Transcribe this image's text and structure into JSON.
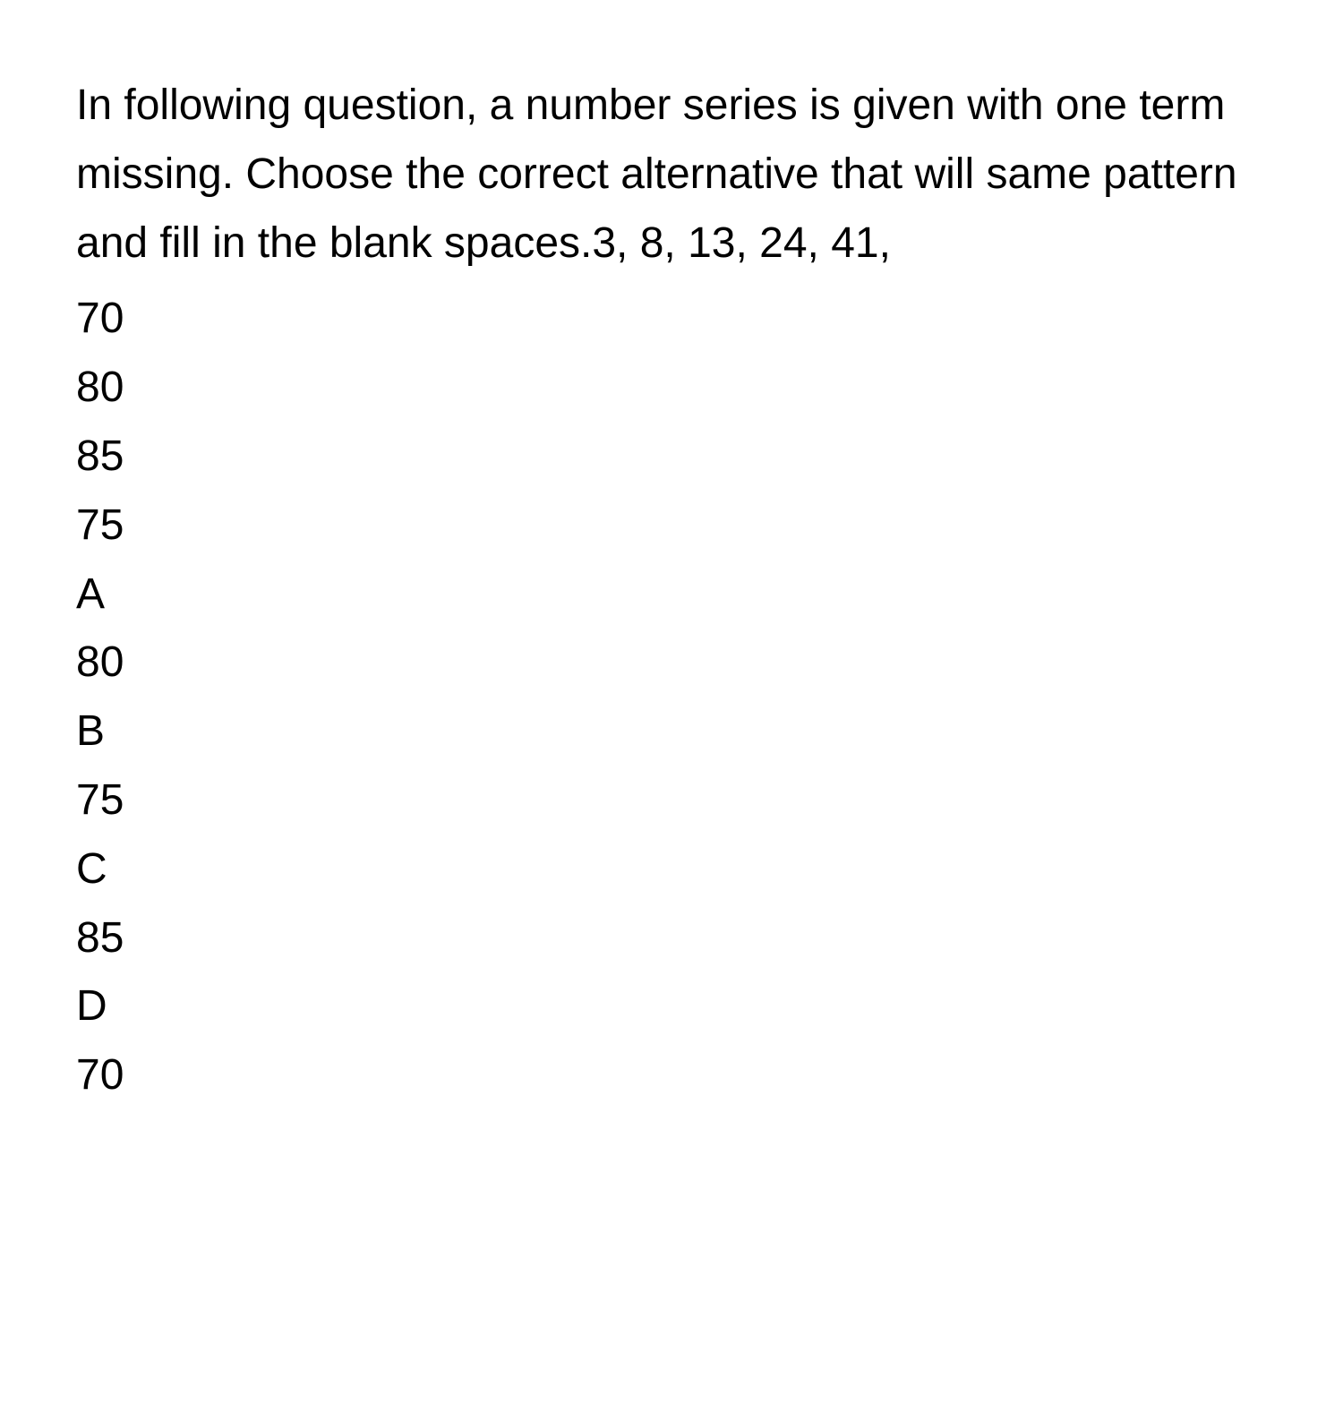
{
  "question": {
    "text": "In following question, a number series is given with one term missing. Choose the correct alternative that will same pattern and fill in the blank spaces.3, 8, 13, 24, 41,"
  },
  "initial_options": [
    "70",
    "80",
    "85",
    "75"
  ],
  "answer_options": [
    {
      "label": "A",
      "value": "80"
    },
    {
      "label": "B",
      "value": "75"
    },
    {
      "label": "C",
      "value": "85"
    },
    {
      "label": "D",
      "value": "70"
    }
  ]
}
